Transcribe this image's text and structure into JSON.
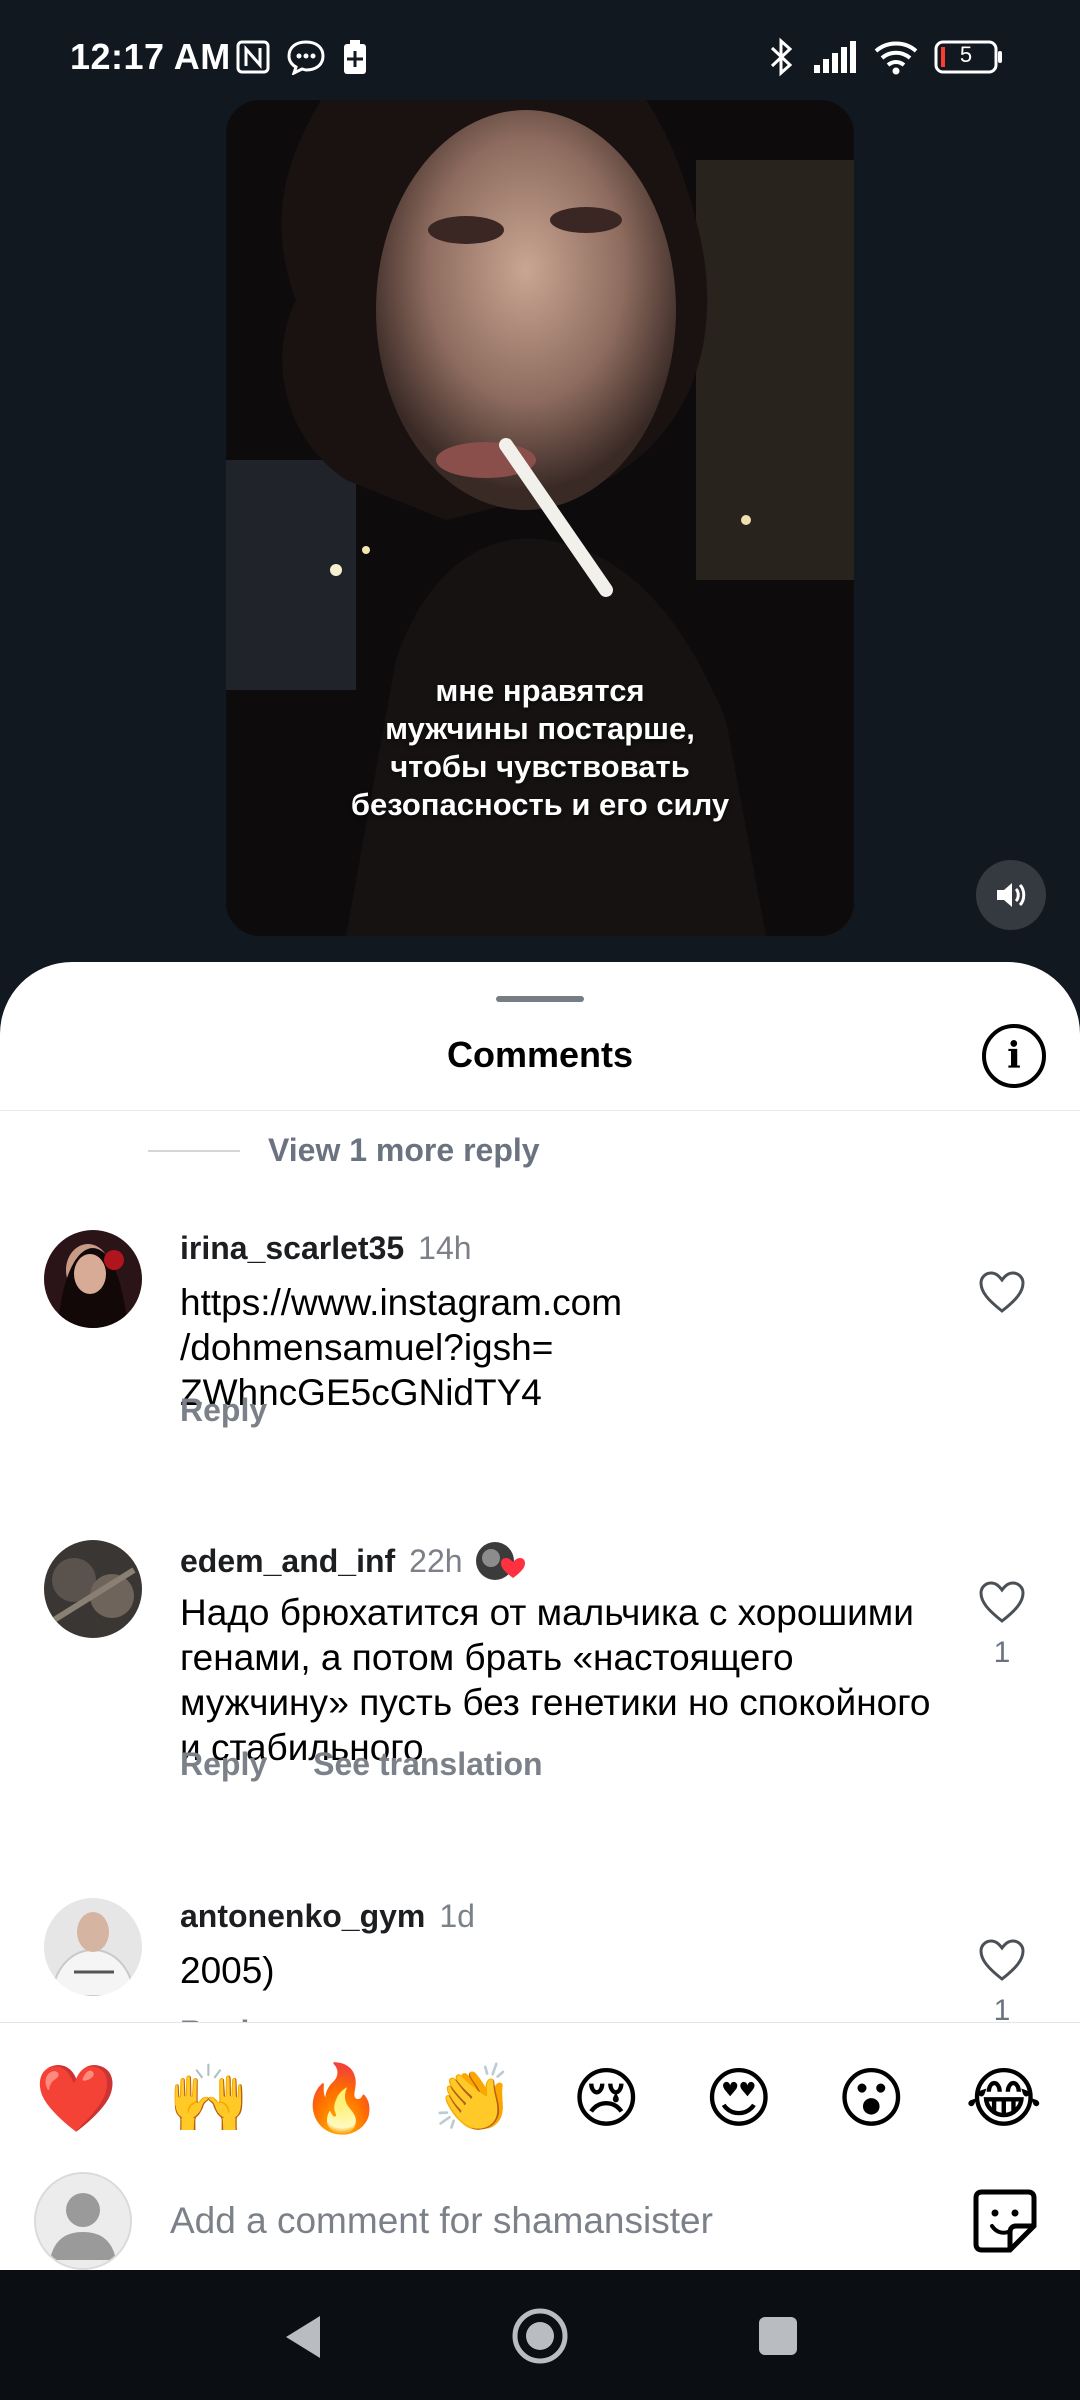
{
  "status_bar": {
    "time": "12:17 AM",
    "battery_level": "5",
    "icons": [
      "nfc-icon",
      "chat-bubble-icon",
      "battery-saver-icon",
      "bluetooth-icon",
      "signal-icon",
      "wifi-icon",
      "battery-icon"
    ]
  },
  "video": {
    "caption_lines": [
      "мне нравятся",
      "мужчины постарше,",
      "чтобы чувствовать",
      "безопасность и его силу"
    ],
    "volume_icon": "speaker-icon"
  },
  "sheet": {
    "title": "Comments",
    "info_icon": "info-icon",
    "view_more": "View 1 more reply"
  },
  "comments": [
    {
      "username": "irina_scarlet35",
      "time": "14h",
      "text": "https://www.instagram.com\n/dohmensamuel?igsh=\nZWhncGE5cGNidTY4",
      "actions": [
        "Reply"
      ],
      "likes": ""
    },
    {
      "username": "edem_and_inf",
      "time": "22h",
      "text": "Надо брюхатится от мальчика с хорошими генами, а потом брать «настоящего мужчину» пусть без генетики но спокойного и стабильного",
      "actions": [
        "Reply",
        "See translation"
      ],
      "likes": "1"
    },
    {
      "username": "antonenko_gym",
      "time": "1d",
      "text": "2005)",
      "actions": [
        "Reply"
      ],
      "likes": "1"
    }
  ],
  "emoji_bar": [
    "❤️",
    "🙌",
    "🔥",
    "👏",
    "😢",
    "😍",
    "😮",
    "😂"
  ],
  "composer": {
    "placeholder": "Add a comment for shamansister",
    "sticker_icon": "sticker-icon"
  },
  "nav_bar": {
    "buttons": [
      "back-icon",
      "home-icon",
      "recents-icon"
    ]
  },
  "colors": {
    "background_dark": "#121820",
    "sheet": "#ffffff",
    "muted_text": "#7b8089",
    "like_red": "#ff3040"
  }
}
